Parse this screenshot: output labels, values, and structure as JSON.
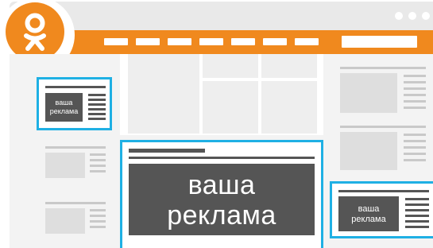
{
  "header": {
    "logo_icon": "odnoklassniki-logo-icon",
    "window_dots": 3,
    "brand_color": "#f0891e"
  },
  "ads": {
    "small_left": {
      "line1": "ваша",
      "line2": "реклама"
    },
    "center": {
      "line1": "ваша",
      "line2": "реклама"
    },
    "bottom_right": {
      "line1": "ваша",
      "line2": "реклама"
    }
  },
  "colors": {
    "accent": "#1fb0e4",
    "ad_fill": "#555555",
    "placeholder": "#dedede"
  }
}
